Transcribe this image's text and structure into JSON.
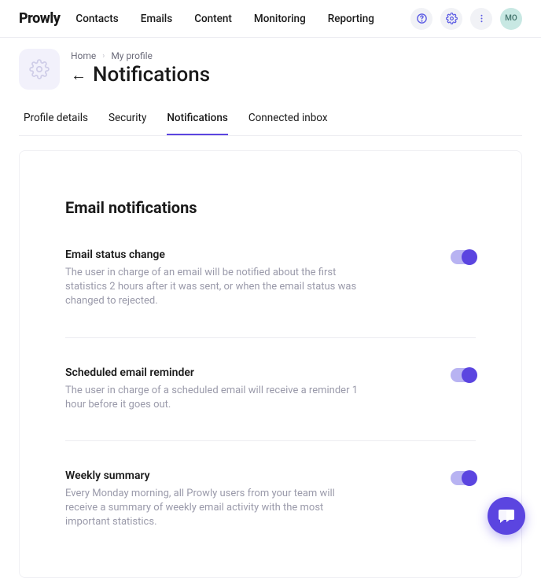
{
  "brand": "Prowly",
  "nav": {
    "contacts": "Contacts",
    "emails": "Emails",
    "content": "Content",
    "monitoring": "Monitoring",
    "reporting": "Reporting"
  },
  "avatar_initials": "MO",
  "breadcrumb": {
    "home": "Home",
    "my_profile": "My profile"
  },
  "page_title": "Notifications",
  "tabs": {
    "profile_details": "Profile details",
    "security": "Security",
    "notifications": "Notifications",
    "connected_inbox": "Connected inbox"
  },
  "section_title": "Email notifications",
  "settings": [
    {
      "title": "Email status change",
      "desc": "The user in charge of an email will be notified about the first statistics 2 hours after it was sent, or when the email status was changed to rejected.",
      "on": true
    },
    {
      "title": "Scheduled email reminder",
      "desc": "The user in charge of a scheduled email will receive a reminder 1 hour before it goes out.",
      "on": true
    },
    {
      "title": "Weekly summary",
      "desc": "Every Monday morning, all Prowly users from your team will receive a summary of weekly email activity with the most important statistics.",
      "on": true
    }
  ]
}
